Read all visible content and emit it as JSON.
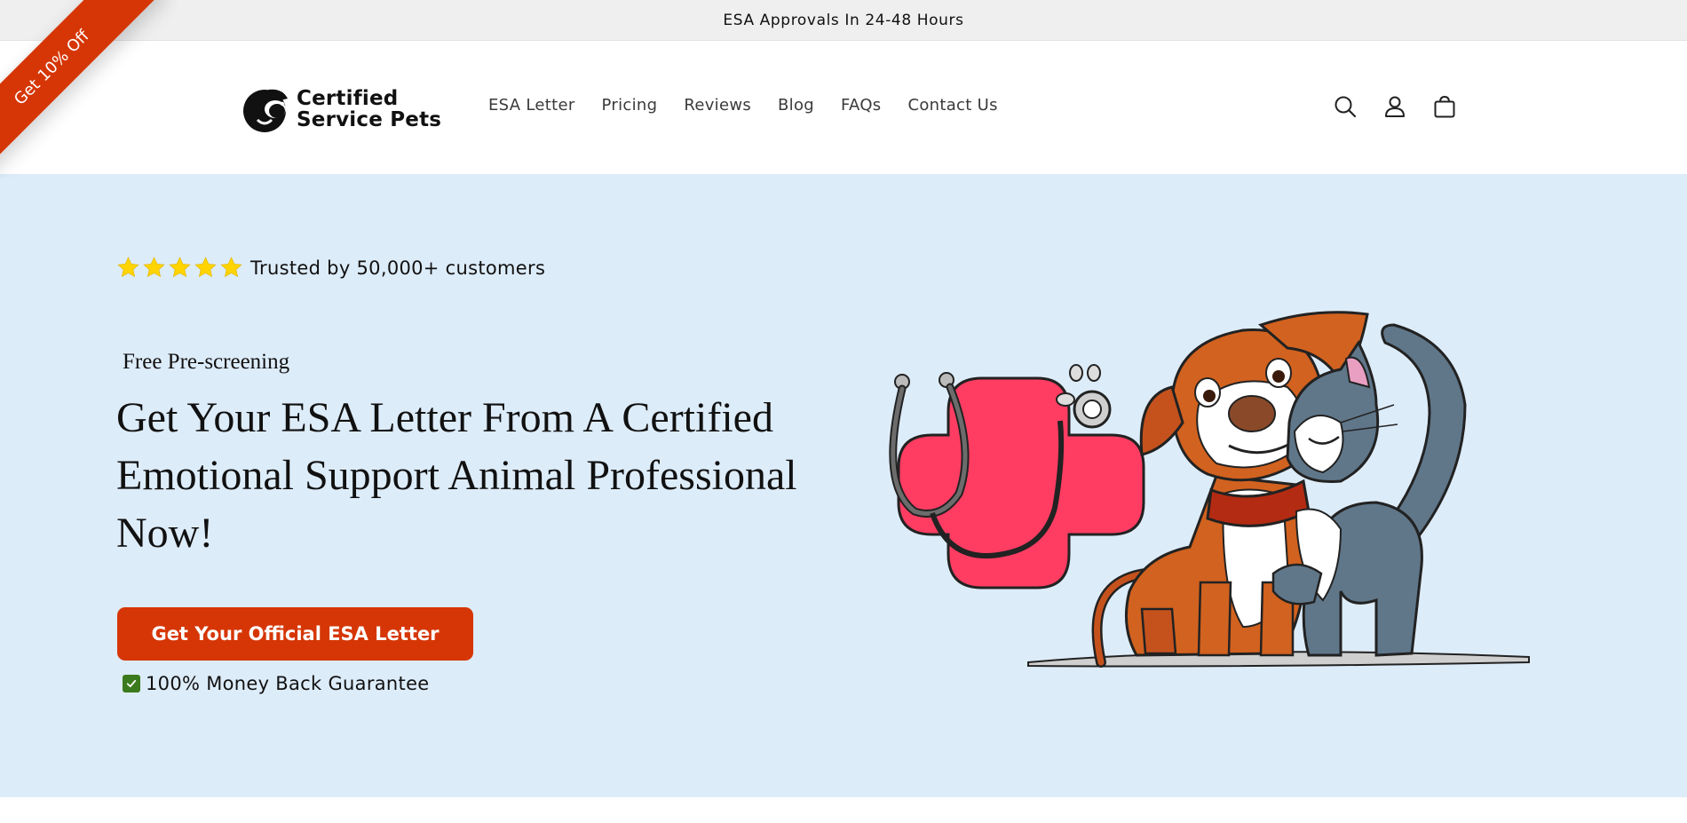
{
  "announcement": {
    "text": "ESA Approvals In 24-48 Hours"
  },
  "ribbon": {
    "text": "Get 10% Off"
  },
  "logo": {
    "line1": "Certified",
    "line2": "Service Pets"
  },
  "nav": {
    "items": [
      "ESA Letter",
      "Pricing",
      "Reviews",
      "Blog",
      "FAQs",
      "Contact Us"
    ]
  },
  "header_icons": [
    "search-icon",
    "account-icon",
    "cart-icon"
  ],
  "hero": {
    "trust_text": "Trusted by 50,000+ customers",
    "star_count": 5,
    "pre_heading": "Free Pre-screening",
    "headline": "Get Your ESA Letter From A Certified Emotional Support Animal Professional Now!",
    "cta_label": "Get Your Official ESA Letter",
    "guarantee_text": "100% Money Back Guarantee"
  },
  "colors": {
    "accent": "#d63606",
    "hero_bg": "#ddecf9",
    "announcement_bg": "#efefef",
    "star": "#ffd400",
    "check": "#3b7a1d"
  }
}
